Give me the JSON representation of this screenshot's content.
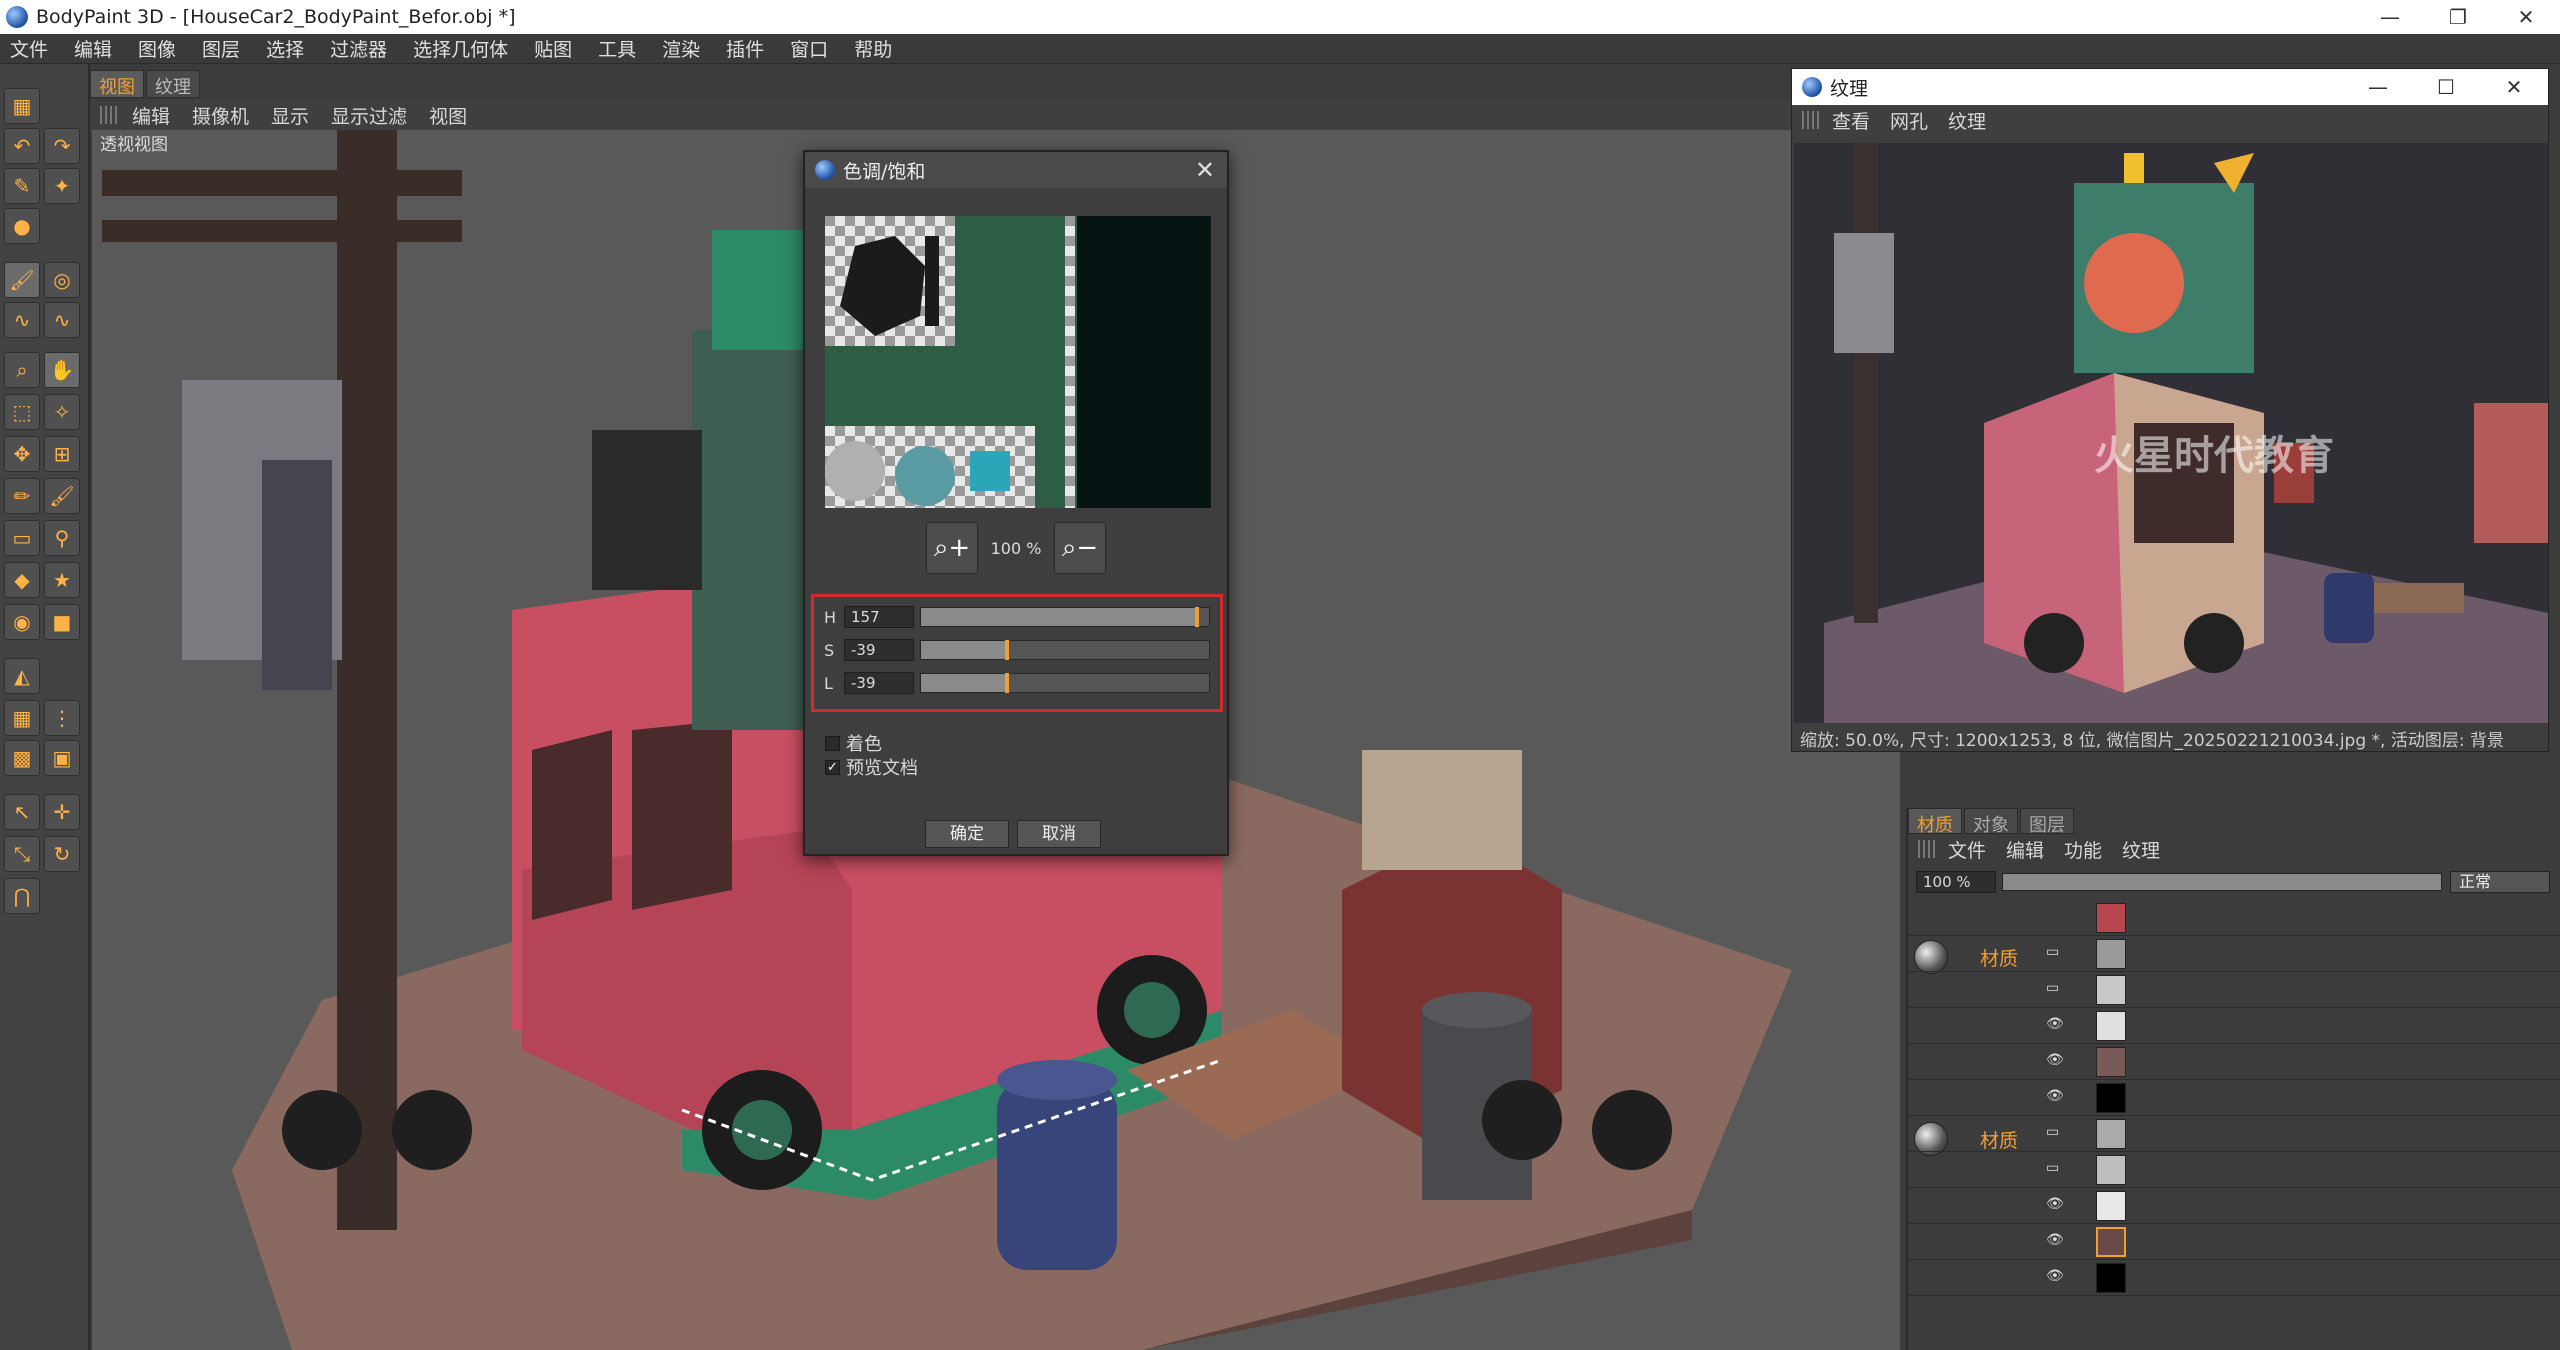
{
  "window": {
    "title": "BodyPaint 3D - [HouseCar2_BodyPaint_Befor.obj *]",
    "minimize": "—",
    "maximize": "❐",
    "close": "✕"
  },
  "menubar": [
    "文件",
    "编辑",
    "图像",
    "图层",
    "选择",
    "过滤器",
    "选择几何体",
    "贴图",
    "工具",
    "渲染",
    "插件",
    "窗口",
    "帮助"
  ],
  "viewport": {
    "tabs": [
      {
        "label": "视图",
        "active": true
      },
      {
        "label": "纹理",
        "active": false
      }
    ],
    "menu": [
      "编辑",
      "摄像机",
      "显示",
      "显示过滤",
      "视图"
    ],
    "label": "透视视图"
  },
  "dialog": {
    "title": "色调/饱和",
    "close": "✕",
    "zoom_in_icon": "magnify-plus-icon",
    "zoom_value": "100 %",
    "zoom_out_icon": "magnify-minus-icon",
    "hue": {
      "label": "H",
      "value": "157",
      "fraction": 0.96
    },
    "saturation": {
      "label": "S",
      "value": "-39",
      "fraction": 0.3
    },
    "lightness": {
      "label": "L",
      "value": "-39",
      "fraction": 0.3
    },
    "colorize": {
      "label": "着色",
      "checked": false
    },
    "preview": {
      "label": "预览文档",
      "checked": true
    },
    "ok": "确定",
    "cancel": "取消"
  },
  "texture_window": {
    "title": "纹理",
    "minimize": "—",
    "maximize": "☐",
    "close": "✕",
    "menu": [
      "查看",
      "网孔",
      "纹理"
    ],
    "watermark": "火星时代教育",
    "status": "缩放: 50.0%, 尺寸: 1200x1253, 8 位, 微信图片_20250221210034.jpg *, 活动图层: 背景"
  },
  "material_panel": {
    "tabs": [
      {
        "label": "材质",
        "active": true
      },
      {
        "label": "对象",
        "active": false
      },
      {
        "label": "图层",
        "active": false
      }
    ],
    "menu": [
      "文件",
      "编辑",
      "功能",
      "纹理"
    ],
    "opacity": "100 %",
    "blend_mode": "正常",
    "group1_label": "材质",
    "group2_label": "材质"
  },
  "colors": {
    "accent": "#f0a030",
    "highlight_box": "#d32a2a"
  }
}
